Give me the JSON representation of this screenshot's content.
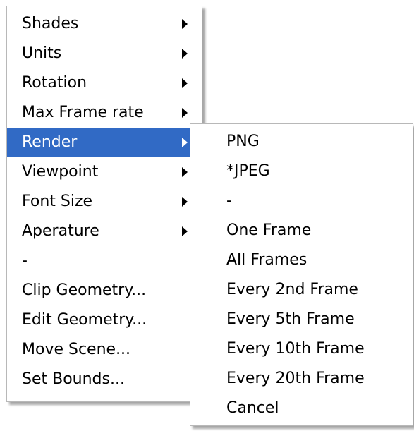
{
  "main_menu": {
    "items": [
      {
        "label": "Shades",
        "submenu": true
      },
      {
        "label": "Units",
        "submenu": true
      },
      {
        "label": "Rotation",
        "submenu": true
      },
      {
        "label": "Max Frame rate",
        "submenu": true
      },
      {
        "label": "Render",
        "submenu": true,
        "active": true
      },
      {
        "label": "Viewpoint",
        "submenu": true
      },
      {
        "label": "Font Size",
        "submenu": true
      },
      {
        "label": "Aperature",
        "submenu": true
      },
      {
        "label": "-",
        "submenu": false
      },
      {
        "label": "Clip Geometry...",
        "submenu": false
      },
      {
        "label": "Edit Geometry...",
        "submenu": false
      },
      {
        "label": "Move Scene...",
        "submenu": false
      },
      {
        "label": "Set Bounds...",
        "submenu": false
      }
    ]
  },
  "render_submenu": {
    "items": [
      {
        "label": "PNG"
      },
      {
        "label": "*JPEG"
      },
      {
        "label": "-"
      },
      {
        "label": "One Frame"
      },
      {
        "label": "All Frames"
      },
      {
        "label": "Every 2nd Frame"
      },
      {
        "label": "Every 5th Frame"
      },
      {
        "label": "Every 10th Frame"
      },
      {
        "label": "Every 20th Frame"
      },
      {
        "label": "Cancel"
      }
    ]
  },
  "colors": {
    "highlight": "#316ac5",
    "highlight_text": "#ffffff",
    "menu_background": "#ffffff"
  }
}
